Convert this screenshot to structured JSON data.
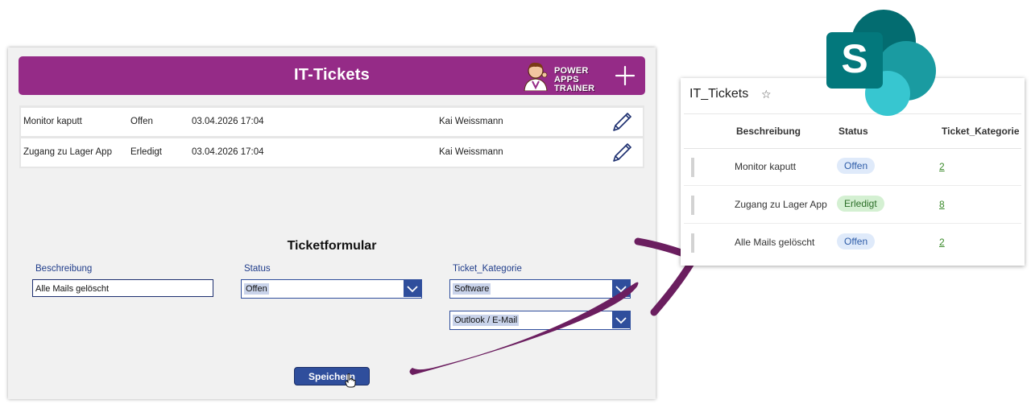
{
  "app": {
    "title": "IT-Tickets",
    "brand_line1": "POWER APPS",
    "brand_line2": "TRAINER",
    "gallery": [
      {
        "beschreibung": "Monitor kaputt",
        "status": "Offen",
        "datum": "03.04.2026 17:04",
        "user": "Kai Weissmann"
      },
      {
        "beschreibung": "Zugang zu Lager App",
        "status": "Erledigt",
        "datum": "03.04.2026 17:04",
        "user": "Kai Weissmann"
      }
    ],
    "form": {
      "title": "Ticketformular",
      "beschreibung_label": "Beschreibung",
      "beschreibung_value": "Alle Mails gelöscht",
      "status_label": "Status",
      "status_value": "Offen",
      "kategorie_label": "Ticket_Kategorie",
      "kategorie_value": "Software",
      "unterkategorie_value": "Outlook / E-Mail",
      "save_label": "Speichern"
    }
  },
  "sharepoint": {
    "list_title": "IT_Tickets",
    "columns": [
      "Beschreibung",
      "Status",
      "Ticket_Kategorie"
    ],
    "rows": [
      {
        "beschreibung": "Monitor kaputt",
        "status": "Offen",
        "kategorie": "2"
      },
      {
        "beschreibung": "Zugang zu Lager App",
        "status": "Erledigt",
        "kategorie": "8"
      },
      {
        "beschreibung": "Alle Mails gelöscht",
        "status": "Offen",
        "kategorie": "2"
      }
    ]
  },
  "colors": {
    "header_purple": "#952b87",
    "accent_blue": "#2f4e9c",
    "arrow_purple": "#6b1e5f",
    "sharepoint_teal": "#03787c"
  },
  "icons": [
    "add-icon",
    "pencil-icon",
    "chevron-down-icon",
    "star-icon",
    "sharepoint-logo-icon",
    "hand-cursor-icon"
  ]
}
